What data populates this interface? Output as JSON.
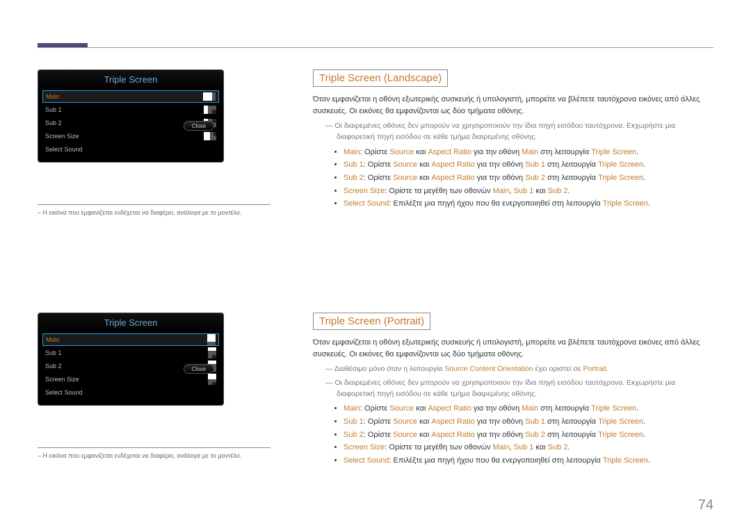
{
  "page_number": "74",
  "left": {
    "menu_title": "Triple Screen",
    "items": [
      "Main",
      "Sub 1",
      "Sub 2",
      "Screen Size",
      "Select Sound"
    ],
    "close": "Close",
    "note": "Η εικόνα που εμφανίζεται ενδέχεται να διαφέρει, ανάλογα με το μοντέλο."
  },
  "landscape": {
    "heading": "Triple Screen (Landscape)",
    "p": "Όταν εμφανίζεται η οθόνη εξωτερικής συσκευής ή υπολογιστή, μπορείτε να βλέπετε ταυτόχρονα εικόνες από άλλες συσκευές. Οι εικόνες θα εμφανίζονται ως δύο τμήματα οθόνης.",
    "n1": "Οι διαιρεμένες οθόνες δεν μπορούν να χρησιμοποιούν την ίδια πηγή εισόδου ταυτόχρονα. Εκχωρήστε μια διαφορετική πηγή εισόδου σε κάθε τμήμα διαιρεμένης οθόνης.",
    "b": {
      "main_pre": "Main",
      "main_mid1": ": Ορίστε ",
      "src": "Source",
      "and": " και ",
      "ar": "Aspect Ratio",
      "main_mid2": " για την οθόνη ",
      "main_kw": "Main",
      "main_mid3": " στη λειτουργία ",
      "ts": "Triple Screen",
      "dot": ".",
      "sub1_pre": "Sub 1",
      "sub1_mid2": " για την οθόνη ",
      "sub1_kw": "Sub 1",
      "sub2_pre": "Sub 2",
      "sub2_kw": "Sub 2",
      "size_pre": "Screen Size",
      "size_txt": ": Ορίστε τα μεγέθη των οθονών ",
      "size_m": "Main",
      "size_c1": ", ",
      "size_s1": "Sub 1",
      "size_c2": " και ",
      "size_s2": "Sub 2",
      "snd_pre": "Select Sound",
      "snd_txt": ": Επιλέξτε μια πηγή ήχου που θα ενεργοποιηθεί στη λειτουργία "
    }
  },
  "portrait": {
    "heading": "Triple Screen (Portrait)",
    "p": "Όταν εμφανίζεται η οθόνη εξωτερικής συσκευής ή υπολογιστή, μπορείτε να βλέπετε ταυτόχρονα εικόνες από άλλες συσκευές. Οι εικόνες θα εμφανίζονται ως δύο τμήματα οθόνης.",
    "n0a": "Διαθέσιμο μόνο όταν η λειτουργία ",
    "n0kw": "Source Content Orientation",
    "n0b": " έχει οριστεί σε ",
    "n0kw2": "Portrait",
    "n0c": ".",
    "n1": "Οι διαιρεμένες οθόνες δεν μπορούν να χρησιμοποιούν την ίδια πηγή εισόδου ταυτόχρονα. Εκχωρήστε μια διαφορετική πηγή εισόδου σε κάθε τμήμα διαιρεμένης οθόνης."
  }
}
